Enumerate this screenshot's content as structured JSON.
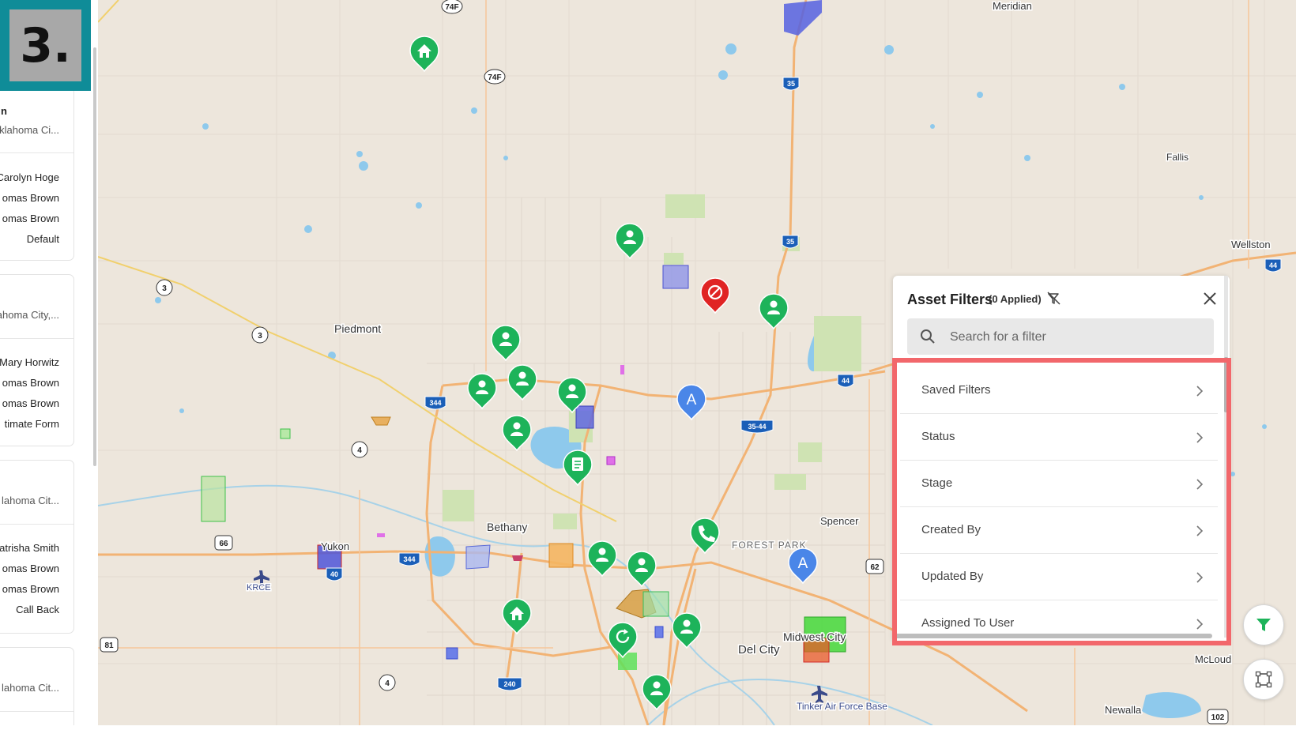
{
  "step": {
    "number": "3."
  },
  "colors": {
    "accent": "#1db35a",
    "highlight": "#f2676b",
    "stepFrame": "#0f8c98",
    "dnc": "#e02424",
    "apt": "#4a86e8"
  },
  "map": {
    "places": [
      {
        "id": "meridian",
        "name": "Meridian"
      },
      {
        "id": "fallis",
        "name": "Fallis"
      },
      {
        "id": "wellston",
        "name": "Wellston"
      },
      {
        "id": "piedmont",
        "name": "Piedmont"
      },
      {
        "id": "bethany",
        "name": "Bethany"
      },
      {
        "id": "yukon",
        "name": "Yukon"
      },
      {
        "id": "spencer",
        "name": "Spencer"
      },
      {
        "id": "forest-park",
        "name": "FOREST PARK"
      },
      {
        "id": "del-city",
        "name": "Del City"
      },
      {
        "id": "midwest-city",
        "name": "Midwest City"
      },
      {
        "id": "mcloud",
        "name": "McLoud"
      },
      {
        "id": "newalla",
        "name": "Newalla"
      },
      {
        "id": "krce",
        "name": "KRCE"
      },
      {
        "id": "tinker",
        "name": "Tinker Air Force Base"
      }
    ],
    "shields": [
      {
        "label": "74F"
      },
      {
        "label": "74F"
      },
      {
        "label": "3"
      },
      {
        "label": "3"
      },
      {
        "label": "4"
      },
      {
        "label": "4"
      },
      {
        "label": "66"
      },
      {
        "label": "81"
      },
      {
        "label": "62"
      },
      {
        "label": "102"
      },
      {
        "label": "35"
      },
      {
        "label": "35"
      },
      {
        "label": "44"
      },
      {
        "label": "44"
      },
      {
        "label": "344"
      },
      {
        "label": "344"
      },
      {
        "label": "35-44"
      },
      {
        "label": "40"
      },
      {
        "label": "240"
      }
    ]
  },
  "left_panel": {
    "cards": [
      {
        "name": "n",
        "location": "klahoma Ci...",
        "rows": [
          "Carolyn Hoge",
          "omas Brown",
          "omas Brown",
          "Default"
        ]
      },
      {
        "location": "ahoma City,...",
        "rows": [
          "Mary Horwitz",
          "omas Brown",
          "omas Brown",
          "timate Form"
        ]
      },
      {
        "location": "lahoma Cit...",
        "rows": [
          "atrisha Smith",
          "omas Brown",
          "omas Brown",
          "Call Back"
        ]
      },
      {
        "location": "lahoma Cit..."
      }
    ]
  },
  "filters": {
    "title": "Asset Filters",
    "applied": "(0 Applied)",
    "search_placeholder": "Search for a filter",
    "items": [
      "Saved Filters",
      "Status",
      "Stage",
      "Created By",
      "Updated By",
      "Assigned To User"
    ]
  },
  "controls": {
    "filter_icon": "funnel-icon",
    "draw_icon": "draw-area-icon"
  }
}
